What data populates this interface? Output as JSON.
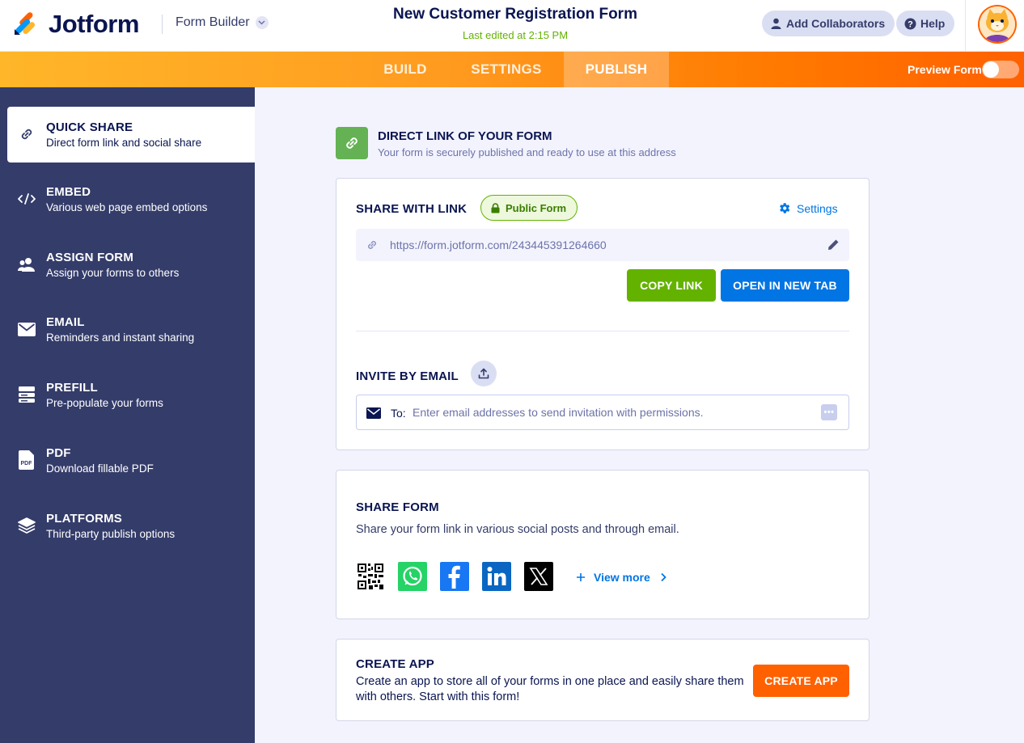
{
  "header": {
    "logo_text": "Jotform",
    "builder_label": "Form Builder",
    "form_title": "New Customer Registration Form",
    "last_edited": "Last edited at 2:15 PM",
    "add_collaborators": "Add Collaborators",
    "help": "Help"
  },
  "tabs": {
    "build": "BUILD",
    "settings": "SETTINGS",
    "publish": "PUBLISH",
    "preview_label": "Preview Form",
    "preview_on": false
  },
  "sidebar": {
    "items": [
      {
        "title": "QUICK SHARE",
        "sub": "Direct form link and social share",
        "icon": "link-icon",
        "active": true
      },
      {
        "title": "EMBED",
        "sub": "Various web page embed options",
        "icon": "code-icon"
      },
      {
        "title": "ASSIGN FORM",
        "sub": "Assign your forms to others",
        "icon": "users-icon"
      },
      {
        "title": "EMAIL",
        "sub": "Reminders and instant sharing",
        "icon": "envelope-icon"
      },
      {
        "title": "PREFILL",
        "sub": "Pre-populate your forms",
        "icon": "prefill-icon"
      },
      {
        "title": "PDF",
        "sub": "Download fillable PDF",
        "icon": "pdf-icon"
      },
      {
        "title": "PLATFORMS",
        "sub": "Third-party publish options",
        "icon": "layers-icon"
      }
    ]
  },
  "direct_link": {
    "title": "DIRECT LINK OF YOUR FORM",
    "subtitle": "Your form is securely published and ready to use at this address"
  },
  "share_link": {
    "title": "SHARE WITH LINK",
    "badge": "Public Form",
    "settings": "Settings",
    "url": "https://form.jotform.com/243445391264660",
    "copy_button": "COPY LINK",
    "open_button": "OPEN IN NEW TAB"
  },
  "invite": {
    "title": "INVITE BY EMAIL",
    "to_label": "To:",
    "placeholder": "Enter email addresses to send invitation with permissions.",
    "more": "•••"
  },
  "share_form": {
    "title": "SHARE FORM",
    "description": "Share your form link in various social posts and through email.",
    "icons": [
      "qr-code-icon",
      "whatsapp-icon",
      "facebook-icon",
      "linkedin-icon",
      "x-icon"
    ],
    "view_more": "View more"
  },
  "create_app": {
    "title": "CREATE APP",
    "description": "Create an app to store all of your forms in one place and easily share them with others. Start with this form!",
    "button": "CREATE APP"
  },
  "colors": {
    "navy": "#0a1551",
    "sidebar": "#343c6a",
    "green": "#64b200",
    "blue": "#0075e3",
    "orange": "#ff6100"
  }
}
